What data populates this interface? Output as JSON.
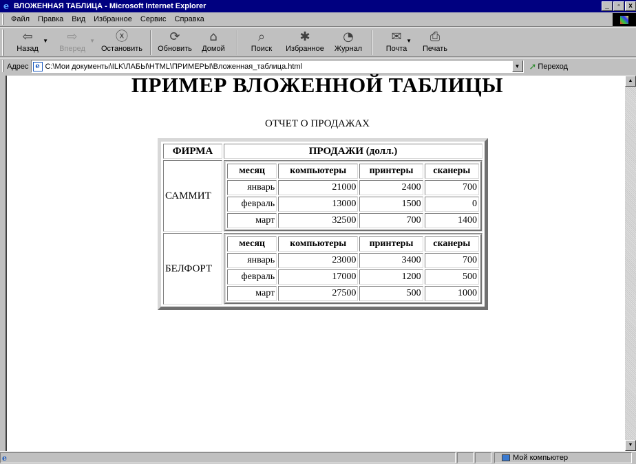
{
  "window": {
    "title": "ВЛОЖЕННАЯ ТАБЛИЦА - Microsoft Internet Explorer",
    "buttons": [
      "_",
      "▫",
      "x"
    ]
  },
  "menu": [
    "Файл",
    "Правка",
    "Вид",
    "Избранное",
    "Сервис",
    "Справка"
  ],
  "toolbar": {
    "back": "Назад",
    "forward": "Вперед",
    "stop": "Остановить",
    "refresh": "Обновить",
    "home": "Домой",
    "search": "Поиск",
    "favorites": "Избранное",
    "history": "Журнал",
    "mail": "Почта",
    "print": "Печать"
  },
  "address": {
    "label": "Адрес",
    "value": "C:\\Мои документы\\ILK\\ЛАБЫ\\HTML\\ПРИМЕРЫ\\Вложенная_таблица.html",
    "go": "Переход"
  },
  "page": {
    "heading": "ПРИМЕР ВЛОЖЕННОЙ ТАБЛИЦЫ",
    "caption": "ОТЧЕТ О ПРОДАЖАХ",
    "col_firm": "ФИРМА",
    "col_sales": "ПРОДАЖИ (долл.)",
    "inner_headers": [
      "месяц",
      "компьютеры",
      "принтеры",
      "сканеры"
    ],
    "firms": [
      {
        "name": "САММИТ",
        "rows": [
          [
            "январь",
            "21000",
            "2400",
            "700"
          ],
          [
            "февраль",
            "13000",
            "1500",
            "0"
          ],
          [
            "март",
            "32500",
            "700",
            "1400"
          ]
        ]
      },
      {
        "name": "БЕЛФОРТ",
        "rows": [
          [
            "январь",
            "23000",
            "3400",
            "700"
          ],
          [
            "февраль",
            "17000",
            "1200",
            "500"
          ],
          [
            "март",
            "27500",
            "500",
            "1000"
          ]
        ]
      }
    ]
  },
  "status": {
    "zone": "Мой компьютер"
  }
}
